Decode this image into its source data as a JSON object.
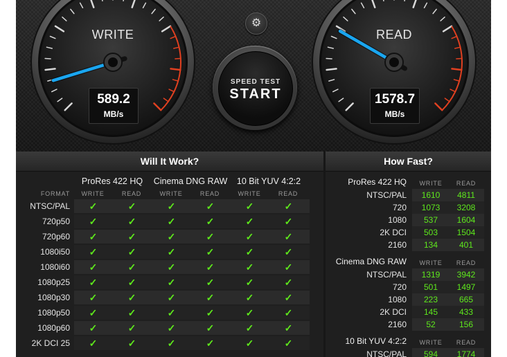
{
  "gauges": {
    "write": {
      "title": "WRITE",
      "value": "589.2",
      "unit": "MB/s"
    },
    "read": {
      "title": "READ",
      "value": "1578.7",
      "unit": "MB/s"
    }
  },
  "controls": {
    "settings_icon": "gear-icon",
    "start_small": "SPEED TEST",
    "start_big": "START"
  },
  "will_it_work": {
    "title": "Will It Work?",
    "format_label": "FORMAT",
    "codecs": [
      "ProRes 422 HQ",
      "Cinema DNG RAW",
      "10 Bit YUV 4:2:2"
    ],
    "write_label": "WRITE",
    "read_label": "READ",
    "check_symbol": "✓",
    "rows": [
      "NTSC/PAL",
      "720p50",
      "720p60",
      "1080i50",
      "1080i60",
      "1080p25",
      "1080p30",
      "1080p50",
      "1080p60",
      "2K DCI 25"
    ]
  },
  "how_fast": {
    "title": "How Fast?",
    "write_label": "WRITE",
    "read_label": "READ",
    "groups": [
      {
        "name": "ProRes 422 HQ",
        "rows": [
          {
            "format": "NTSC/PAL",
            "write": "1610",
            "read": "4811"
          },
          {
            "format": "720",
            "write": "1073",
            "read": "3208"
          },
          {
            "format": "1080",
            "write": "537",
            "read": "1604"
          },
          {
            "format": "2K DCI",
            "write": "503",
            "read": "1504"
          },
          {
            "format": "2160",
            "write": "134",
            "read": "401"
          }
        ]
      },
      {
        "name": "Cinema DNG RAW",
        "rows": [
          {
            "format": "NTSC/PAL",
            "write": "1319",
            "read": "3942"
          },
          {
            "format": "720",
            "write": "501",
            "read": "1497"
          },
          {
            "format": "1080",
            "write": "223",
            "read": "665"
          },
          {
            "format": "2K DCI",
            "write": "145",
            "read": "433"
          },
          {
            "format": "2160",
            "write": "52",
            "read": "156"
          }
        ]
      },
      {
        "name": "10 Bit YUV 4:2:2",
        "rows": [
          {
            "format": "NTSC/PAL",
            "write": "594",
            "read": "1774"
          }
        ]
      }
    ]
  },
  "colors": {
    "accent_needle": "#1aa6f0",
    "check_green": "#5ee81c",
    "redline": "#e04020"
  }
}
